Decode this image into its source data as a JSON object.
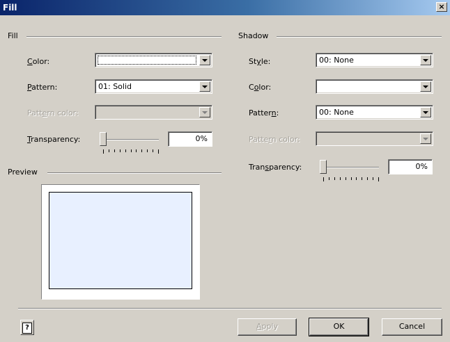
{
  "dialog": {
    "title": "Fill",
    "close_glyph": "×"
  },
  "fill": {
    "group_label": "Fill",
    "color_label_mn": "C",
    "color_label_rest": "olor:",
    "color_value": "",
    "pattern_label_mn": "P",
    "pattern_label_rest": "attern:",
    "pattern_value": "01: Solid",
    "pattern_color_label_pre": "Patt",
    "pattern_color_label_mn": "e",
    "pattern_color_label_post": "rn color:",
    "pattern_color_value": "",
    "transparency_label_mn": "T",
    "transparency_label_rest": "ransparency:",
    "transparency_value": "0%",
    "transparency_level": 0
  },
  "preview": {
    "group_label": "Preview",
    "fill_color": "#e8f0ff"
  },
  "shadow": {
    "group_label": "Shadow",
    "style_label_pre": "St",
    "style_label_mn": "y",
    "style_label_post": "le:",
    "style_value": "00: None",
    "color_label_pre": "C",
    "color_label_mn": "o",
    "color_label_post": "lor:",
    "color_value": "",
    "pattern_label_pre": "Patter",
    "pattern_label_mn": "n",
    "pattern_label_post": ":",
    "pattern_value": "00: None",
    "pattern_color_label_pre": "Patte",
    "pattern_color_label_mn": "r",
    "pattern_color_label_post": "n color:",
    "pattern_color_value": "",
    "transparency_label_pre": "Tran",
    "transparency_label_mn": "s",
    "transparency_label_post": "parency:",
    "transparency_value": "0%",
    "transparency_level": 0
  },
  "buttons": {
    "help_glyph": "?",
    "apply_mn": "A",
    "apply_rest": "pply",
    "ok": "OK",
    "cancel": "Cancel"
  },
  "icons": {
    "help": "help-icon",
    "close": "close-icon",
    "dropdown": "chevron-down-icon"
  },
  "colors": {
    "title_start": "#0a246a",
    "title_end": "#a6caf0",
    "face": "#d4d0c8"
  }
}
